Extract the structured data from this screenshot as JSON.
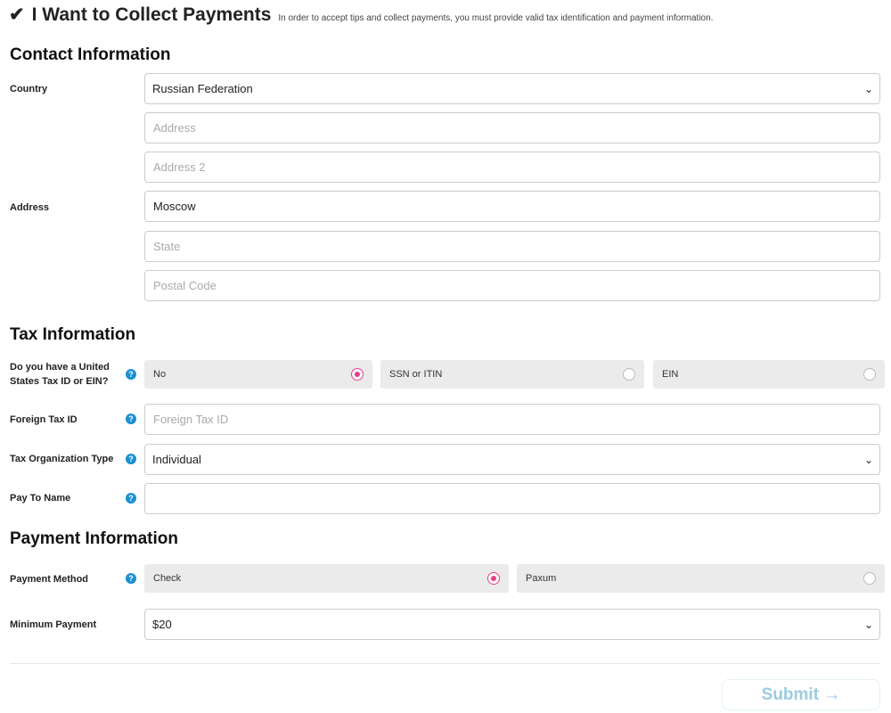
{
  "header": {
    "title": "I Want to Collect Payments",
    "subtitle": "In order to accept tips and collect payments, you must provide valid tax identification and payment information.",
    "icon": "checkmark-icon"
  },
  "contact": {
    "heading": "Contact Information",
    "country_label": "Country",
    "country_value": "Russian Federation",
    "address_label": "Address",
    "address_placeholder": "Address",
    "address2_placeholder": "Address 2",
    "city_value": "Moscow",
    "state_placeholder": "State",
    "postal_placeholder": "Postal Code"
  },
  "tax": {
    "heading": "Tax Information",
    "us_tax_label": "Do you have a United States Tax ID or EIN?",
    "options": [
      "No",
      "SSN or ITIN",
      "EIN"
    ],
    "selected": "No",
    "foreign_label": "Foreign Tax ID",
    "foreign_placeholder": "Foreign Tax ID",
    "org_label": "Tax Organization Type",
    "org_value": "Individual",
    "payto_label": "Pay To Name",
    "payto_value": ""
  },
  "payment": {
    "heading": "Payment Information",
    "method_label": "Payment Method",
    "methods": [
      "Check",
      "Paxum"
    ],
    "selected": "Check",
    "min_label": "Minimum Payment",
    "min_value": "$20"
  },
  "submit": {
    "label": "Submit →"
  },
  "colors": {
    "accent_radio": "#e83e8c",
    "help": "#1a8fd6",
    "submit_text": "#9ccbe0"
  }
}
